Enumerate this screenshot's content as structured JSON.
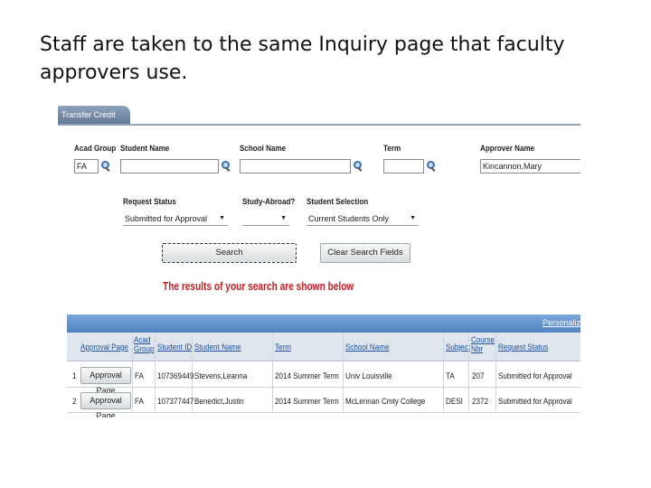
{
  "slide": {
    "text": "Staff are taken to the same Inquiry page that faculty approvers use."
  },
  "page": {
    "tab_title": "Transfer Credit Inquiry"
  },
  "search": {
    "acad_group_label": "Acad Group",
    "acad_group_value": "FA",
    "student_name_label": "Student Name",
    "student_name_value": "",
    "school_name_label": "School Name",
    "school_name_value": "",
    "term_label": "Term",
    "term_value": "",
    "approver_name_label": "Approver Name",
    "approver_name_value": "Kincannon,Mary",
    "request_status_label": "Request Status",
    "request_status_value": "Submitted for Approval",
    "study_abroad_label": "Study-Abroad?",
    "study_abroad_value": "",
    "student_selection_label": "Student Selection",
    "student_selection_value": "Current Students Only",
    "search_button": "Search",
    "clear_button": "Clear Search Fields",
    "results_message": "The results of your search are shown below"
  },
  "grid": {
    "personalize": "Personaliz",
    "headers": {
      "approval_page": "Approval Page",
      "acad_group": "Acad Group",
      "student_id": "Student ID",
      "student_name": "Student Name",
      "term": "Term",
      "school_name": "School Name",
      "subject": "Subject",
      "course_nbr": "Course Nbr",
      "request_status": "Request Status"
    },
    "rows": [
      {
        "num": "1",
        "button": "Approval Page",
        "acad_group": "FA",
        "student_id": "107369449",
        "student_name": "Stevens,Leanna",
        "term": "2014 Summer Term",
        "school_name": "Univ Louisville",
        "subject": "TA",
        "course_nbr": "207",
        "request_status": "Submitted for Approval"
      },
      {
        "num": "2",
        "button": "Approval Page",
        "acad_group": "FA",
        "student_id": "107377447",
        "student_name": "Benedict,Justin",
        "term": "2014 Summer Term",
        "school_name": "McLennan Cmty College",
        "subject": "DESI",
        "course_nbr": "2372",
        "request_status": "Submitted for Approval"
      }
    ]
  },
  "colors": {
    "accent": "#4f83c2",
    "error_text": "#c81d25",
    "link": "#1d4fa0"
  }
}
